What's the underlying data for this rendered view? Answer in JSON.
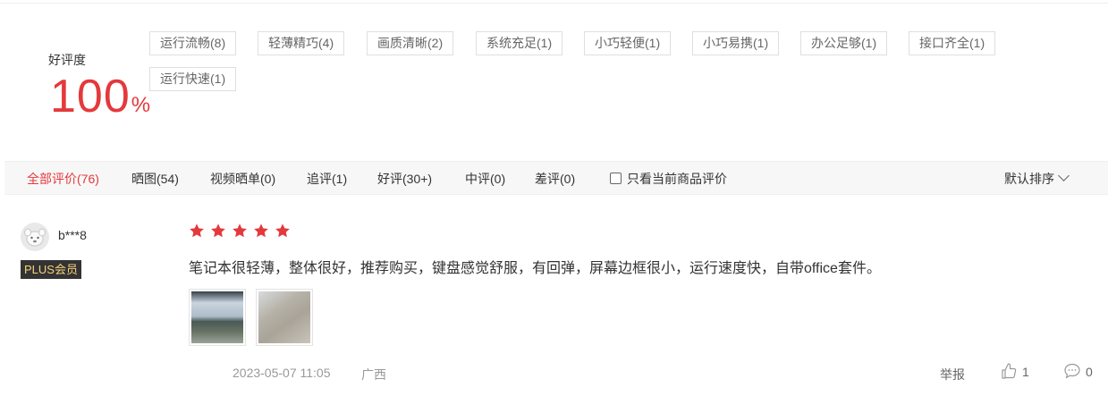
{
  "summary": {
    "rating_label": "好评度",
    "rating_value": "100",
    "rating_unit": "%"
  },
  "tags": [
    "运行流畅(8)",
    "轻薄精巧(4)",
    "画质清晰(2)",
    "系统充足(1)",
    "小巧轻便(1)",
    "小巧易携(1)",
    "办公足够(1)",
    "接口齐全(1)",
    "运行快速(1)"
  ],
  "filters": [
    "全部评价(76)",
    "晒图(54)",
    "视频晒单(0)",
    "追评(1)",
    "好评(30+)",
    "中评(0)",
    "差评(0)"
  ],
  "only_current_label": "只看当前商品评价",
  "sort_label": "默认排序",
  "review": {
    "username": "b***8",
    "badge": "PLUS会员",
    "stars": 5,
    "content": "笔记本很轻薄，整体很好，推荐购买，键盘感觉舒服，有回弹，屏幕边框很小，运行速度快，自带office套件。",
    "date": "2023-05-07 11:05",
    "region": "广西",
    "report_label": "举报",
    "likes": "1",
    "comments": "0"
  },
  "colors": {
    "accent": "#e4393c",
    "tag_border": "#dfdfdf",
    "filter_bg": "#f7f7f7",
    "badge_bg": "#333333",
    "badge_text": "#f5d37a"
  },
  "icons": {
    "star": "star-icon",
    "like": "thumbs-up-icon",
    "comment": "comment-bubble-icon",
    "sort": "chevron-down-icon"
  }
}
